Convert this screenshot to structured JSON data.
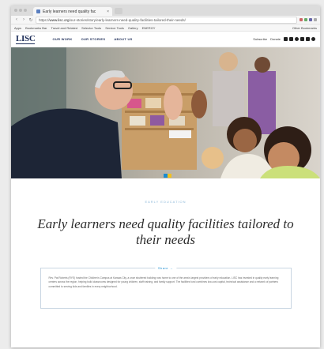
{
  "browser": {
    "tab_title": "Early learners need quality fac",
    "tab_close": "×",
    "url_prefix": "https://",
    "url_host": "www.lisc.org",
    "url_path": "/our-stories/story/early-learners-need-quality-facilities-tailored-their-needs/",
    "nav_back": "‹",
    "nav_forward": "›",
    "nav_reload": "↻",
    "bookmarks": [
      "Apps",
      "Bookmarks Bar",
      "Travel and Related",
      "Selector Tools",
      "Service Tools",
      "Gallery",
      "ENERGY"
    ],
    "bookmarks_right": "Other Bookmarks"
  },
  "site": {
    "logo": "LISC",
    "nav": [
      "OUR WORK",
      "OUR STORIES",
      "ABOUT US"
    ],
    "util_links": [
      "Subscribe",
      "Donate"
    ],
    "donate_button": "DONATE"
  },
  "article": {
    "category": "EARLY EDUCATION",
    "headline": "Early learners need quality facilities tailored to their needs",
    "summary_label": "Share →",
    "summary": "Rev. Pat Roberts (RYE) hosted the Children's Campus at Kansas City, a once shuttered building now home to one of the area's largest providers of early education. LISC has invested in quality early learning centers across the region, helping build classrooms designed for young children, staff training, and family support. The facilities fund combines low-cost capital, technical assistance and a network of partners committed to serving kids and families in every neighborhood."
  },
  "colors": {
    "brand_navy": "#1d2d58",
    "accent_yellow": "#f4c21d",
    "accent_blue": "#1a8bd0"
  }
}
